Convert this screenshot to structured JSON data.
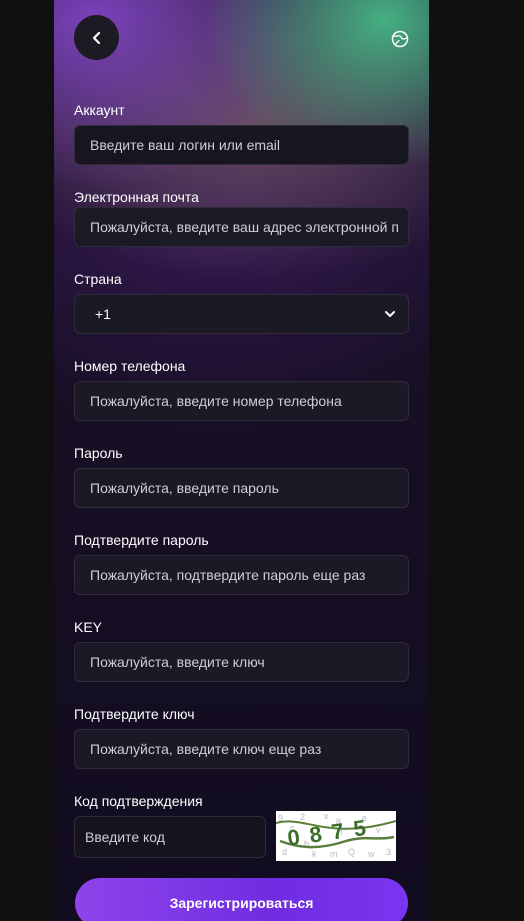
{
  "header": {
    "back_icon": "chevron-left-icon",
    "language_icon": "globe-icon"
  },
  "form": {
    "account": {
      "label": "Аккаунт",
      "placeholder": "Введите ваш логин или email"
    },
    "email": {
      "label": "Электронная почта",
      "placeholder": "Пожалуйста, введите ваш адрес электронной п"
    },
    "country": {
      "label": "Страна",
      "value": "+1"
    },
    "phone": {
      "label": "Номер телефона",
      "placeholder": "Пожалуйста, введите номер телефона"
    },
    "password": {
      "label": "Пароль",
      "placeholder": "Пожалуйста, введите пароль"
    },
    "confirm_password": {
      "label": "Подтвердите пароль",
      "placeholder": "Пожалуйста, подтвердите пароль еще раз"
    },
    "key": {
      "label": "KEY",
      "placeholder": "Пожалуйста, введите ключ"
    },
    "confirm_key": {
      "label": "Подтвердите ключ",
      "placeholder": "Пожалуйста, введите ключ еще раз"
    },
    "verification": {
      "label": "Код подтверждения",
      "placeholder": "Введите код",
      "captcha_text": "0875"
    }
  },
  "submit_label": "Зарегистрироваться",
  "colors": {
    "accent": "#7a35f0",
    "field_bg": "#1c1a26",
    "page_bg": "#101010"
  }
}
